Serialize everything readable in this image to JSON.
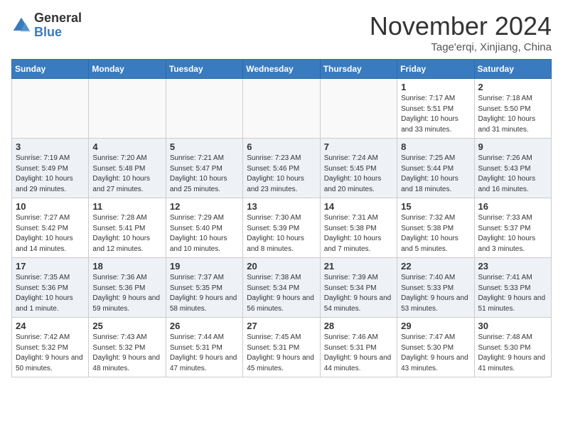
{
  "logo": {
    "general": "General",
    "blue": "Blue"
  },
  "title": "November 2024",
  "location": "Tage'erqi, Xinjiang, China",
  "days_of_week": [
    "Sunday",
    "Monday",
    "Tuesday",
    "Wednesday",
    "Thursday",
    "Friday",
    "Saturday"
  ],
  "weeks": [
    [
      {
        "day": "",
        "info": ""
      },
      {
        "day": "",
        "info": ""
      },
      {
        "day": "",
        "info": ""
      },
      {
        "day": "",
        "info": ""
      },
      {
        "day": "",
        "info": ""
      },
      {
        "day": "1",
        "info": "Sunrise: 7:17 AM\nSunset: 5:51 PM\nDaylight: 10 hours and 33 minutes."
      },
      {
        "day": "2",
        "info": "Sunrise: 7:18 AM\nSunset: 5:50 PM\nDaylight: 10 hours and 31 minutes."
      }
    ],
    [
      {
        "day": "3",
        "info": "Sunrise: 7:19 AM\nSunset: 5:49 PM\nDaylight: 10 hours and 29 minutes."
      },
      {
        "day": "4",
        "info": "Sunrise: 7:20 AM\nSunset: 5:48 PM\nDaylight: 10 hours and 27 minutes."
      },
      {
        "day": "5",
        "info": "Sunrise: 7:21 AM\nSunset: 5:47 PM\nDaylight: 10 hours and 25 minutes."
      },
      {
        "day": "6",
        "info": "Sunrise: 7:23 AM\nSunset: 5:46 PM\nDaylight: 10 hours and 23 minutes."
      },
      {
        "day": "7",
        "info": "Sunrise: 7:24 AM\nSunset: 5:45 PM\nDaylight: 10 hours and 20 minutes."
      },
      {
        "day": "8",
        "info": "Sunrise: 7:25 AM\nSunset: 5:44 PM\nDaylight: 10 hours and 18 minutes."
      },
      {
        "day": "9",
        "info": "Sunrise: 7:26 AM\nSunset: 5:43 PM\nDaylight: 10 hours and 16 minutes."
      }
    ],
    [
      {
        "day": "10",
        "info": "Sunrise: 7:27 AM\nSunset: 5:42 PM\nDaylight: 10 hours and 14 minutes."
      },
      {
        "day": "11",
        "info": "Sunrise: 7:28 AM\nSunset: 5:41 PM\nDaylight: 10 hours and 12 minutes."
      },
      {
        "day": "12",
        "info": "Sunrise: 7:29 AM\nSunset: 5:40 PM\nDaylight: 10 hours and 10 minutes."
      },
      {
        "day": "13",
        "info": "Sunrise: 7:30 AM\nSunset: 5:39 PM\nDaylight: 10 hours and 8 minutes."
      },
      {
        "day": "14",
        "info": "Sunrise: 7:31 AM\nSunset: 5:38 PM\nDaylight: 10 hours and 7 minutes."
      },
      {
        "day": "15",
        "info": "Sunrise: 7:32 AM\nSunset: 5:38 PM\nDaylight: 10 hours and 5 minutes."
      },
      {
        "day": "16",
        "info": "Sunrise: 7:33 AM\nSunset: 5:37 PM\nDaylight: 10 hours and 3 minutes."
      }
    ],
    [
      {
        "day": "17",
        "info": "Sunrise: 7:35 AM\nSunset: 5:36 PM\nDaylight: 10 hours and 1 minute."
      },
      {
        "day": "18",
        "info": "Sunrise: 7:36 AM\nSunset: 5:36 PM\nDaylight: 9 hours and 59 minutes."
      },
      {
        "day": "19",
        "info": "Sunrise: 7:37 AM\nSunset: 5:35 PM\nDaylight: 9 hours and 58 minutes."
      },
      {
        "day": "20",
        "info": "Sunrise: 7:38 AM\nSunset: 5:34 PM\nDaylight: 9 hours and 56 minutes."
      },
      {
        "day": "21",
        "info": "Sunrise: 7:39 AM\nSunset: 5:34 PM\nDaylight: 9 hours and 54 minutes."
      },
      {
        "day": "22",
        "info": "Sunrise: 7:40 AM\nSunset: 5:33 PM\nDaylight: 9 hours and 53 minutes."
      },
      {
        "day": "23",
        "info": "Sunrise: 7:41 AM\nSunset: 5:33 PM\nDaylight: 9 hours and 51 minutes."
      }
    ],
    [
      {
        "day": "24",
        "info": "Sunrise: 7:42 AM\nSunset: 5:32 PM\nDaylight: 9 hours and 50 minutes."
      },
      {
        "day": "25",
        "info": "Sunrise: 7:43 AM\nSunset: 5:32 PM\nDaylight: 9 hours and 48 minutes."
      },
      {
        "day": "26",
        "info": "Sunrise: 7:44 AM\nSunset: 5:31 PM\nDaylight: 9 hours and 47 minutes."
      },
      {
        "day": "27",
        "info": "Sunrise: 7:45 AM\nSunset: 5:31 PM\nDaylight: 9 hours and 45 minutes."
      },
      {
        "day": "28",
        "info": "Sunrise: 7:46 AM\nSunset: 5:31 PM\nDaylight: 9 hours and 44 minutes."
      },
      {
        "day": "29",
        "info": "Sunrise: 7:47 AM\nSunset: 5:30 PM\nDaylight: 9 hours and 43 minutes."
      },
      {
        "day": "30",
        "info": "Sunrise: 7:48 AM\nSunset: 5:30 PM\nDaylight: 9 hours and 41 minutes."
      }
    ]
  ]
}
